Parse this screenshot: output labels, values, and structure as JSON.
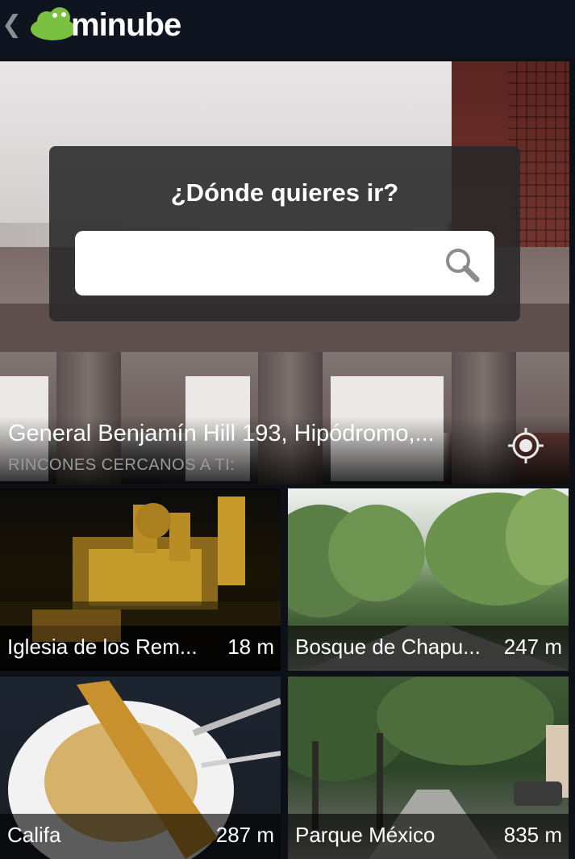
{
  "header": {
    "back_glyph": "❮",
    "logo_text": "minube",
    "brand_color": "#7ac142"
  },
  "hero": {
    "search_title": "¿Dónde quieres ir?",
    "search_value": "",
    "search_placeholder": "",
    "address": "General Benjamín Hill 193, Hipódromo,...",
    "nearby_label": "RINCONES CERCANOS A TI:"
  },
  "places": [
    {
      "name": "Iglesia de los Rem...",
      "distance": "18 m"
    },
    {
      "name": "Bosque de Chapu...",
      "distance": "247 m"
    },
    {
      "name": "Califa",
      "distance": "287 m"
    },
    {
      "name": "Parque México",
      "distance": "835 m"
    }
  ],
  "icons": {
    "search": "search-icon",
    "locate": "locate-icon",
    "back": "chevron-left-icon"
  }
}
